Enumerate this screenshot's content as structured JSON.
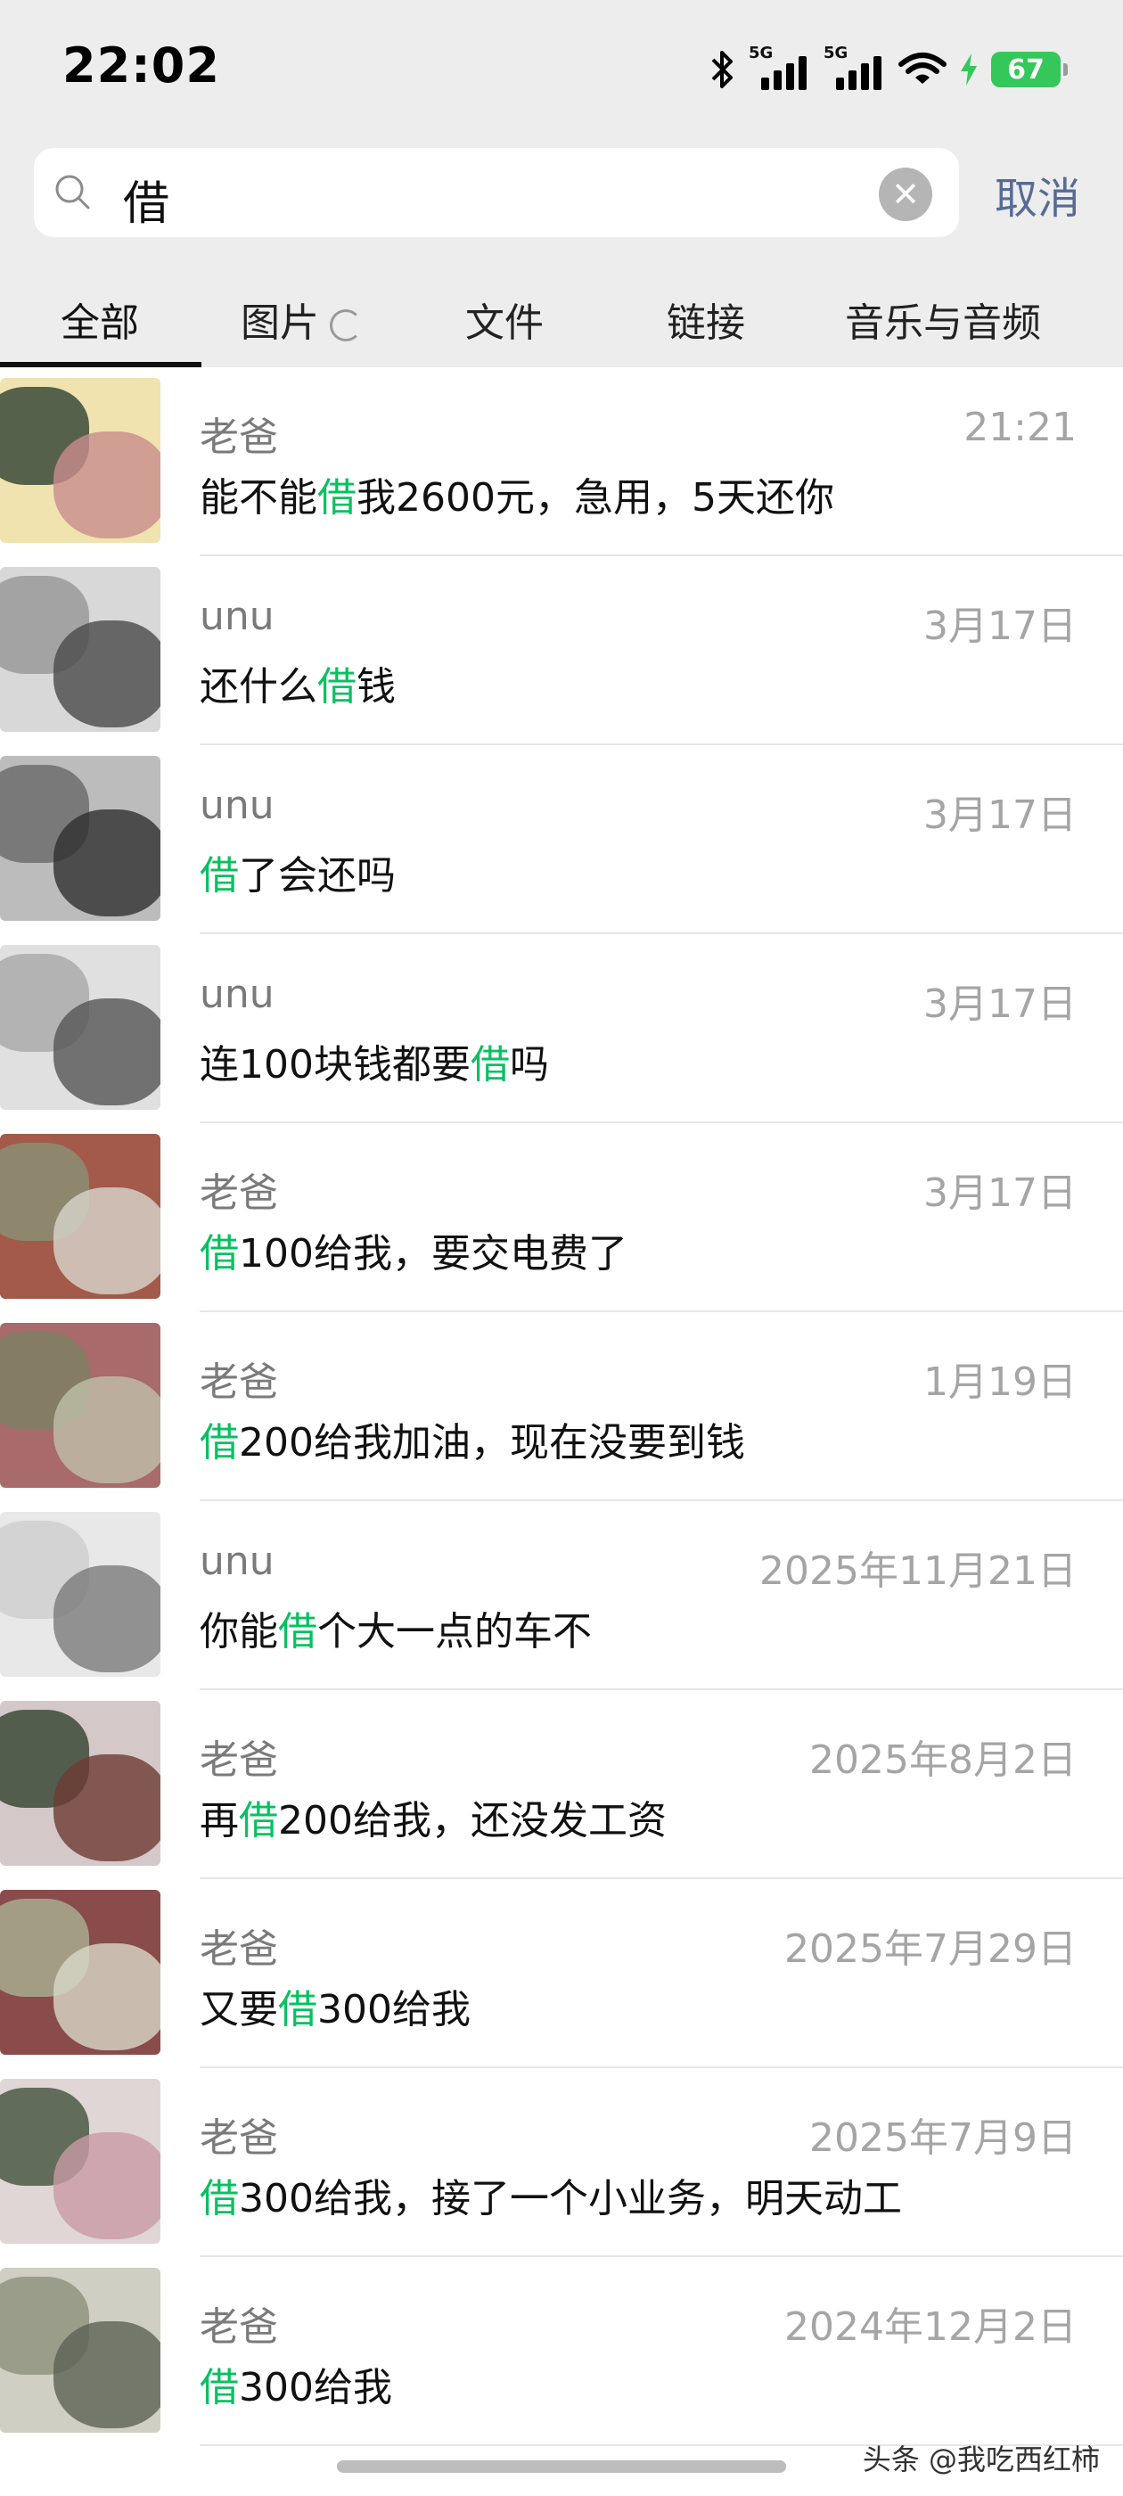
{
  "status_bar": {
    "time": "22:02",
    "network1": "5G",
    "network2": "5G",
    "battery": "67",
    "icons": [
      "bluetooth-icon",
      "signal-icon",
      "signal-icon",
      "wifi-icon",
      "charging-icon",
      "battery-icon"
    ]
  },
  "search": {
    "query": "借",
    "cancel_label": "取消"
  },
  "tabs": [
    {
      "label": "全部",
      "active": true
    },
    {
      "label": "图片",
      "active": false
    },
    {
      "label": "文件",
      "active": false
    },
    {
      "label": "链接",
      "active": false
    },
    {
      "label": "音乐与音频",
      "active": false
    }
  ],
  "results": [
    {
      "name": "老爸",
      "date": "21:21",
      "pre": "能不能",
      "hit": "借",
      "post": "我2600元，急用，5天还你"
    },
    {
      "name": "unu",
      "date": "3月17日",
      "pre": "还什么",
      "hit": "借",
      "post": "钱"
    },
    {
      "name": "unu",
      "date": "3月17日",
      "pre": "",
      "hit": "借",
      "post": "了会还吗"
    },
    {
      "name": "unu",
      "date": "3月17日",
      "pre": "连100块钱都要",
      "hit": "借",
      "post": "吗"
    },
    {
      "name": "老爸",
      "date": "3月17日",
      "pre": "",
      "hit": "借",
      "post": "100给我，要交电费了"
    },
    {
      "name": "老爸",
      "date": "1月19日",
      "pre": "",
      "hit": "借",
      "post": "200给我加油，现在没要到钱"
    },
    {
      "name": "unu",
      "date": "2025年11月21日",
      "pre": "你能",
      "hit": "借",
      "post": "个大一点的车不"
    },
    {
      "name": "老爸",
      "date": "2025年8月2日",
      "pre": "再",
      "hit": "借",
      "post": "200给我，还没发工资"
    },
    {
      "name": "老爸",
      "date": "2025年7月29日",
      "pre": "又要",
      "hit": "借",
      "post": "300给我"
    },
    {
      "name": "老爸",
      "date": "2025年7月9日",
      "pre": "",
      "hit": "借",
      "post": "300给我，接了一个小业务，明天动工"
    },
    {
      "name": "老爸",
      "date": "2024年12月2日",
      "pre": "",
      "hit": "借",
      "post": "300给我"
    }
  ],
  "watermark": "头条 @我吃西红柿",
  "colors": {
    "highlight": "#07c160",
    "cancel": "#576b95",
    "background": "#ededed"
  }
}
